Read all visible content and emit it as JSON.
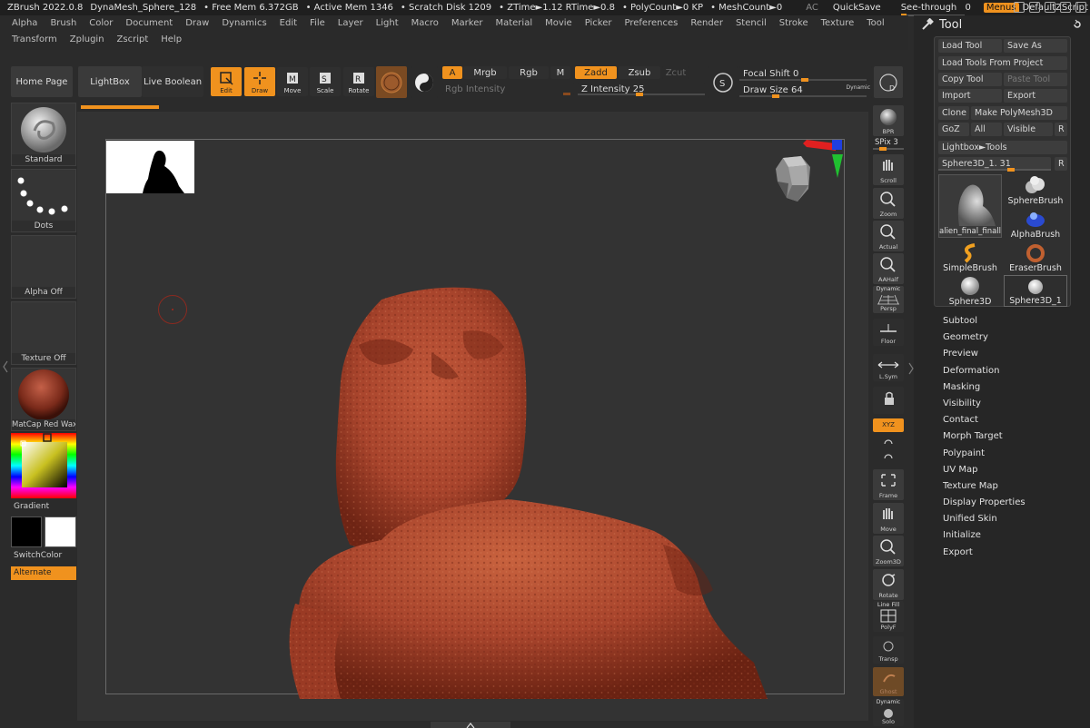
{
  "titlebar": {
    "app": "ZBrush 2022.0.8",
    "document": "DynaMesh_Sphere_128",
    "free_mem": "• Free Mem 6.372GB",
    "active_mem": "• Active Mem 1346",
    "scratch_disk": "• Scratch Disk 1209",
    "timing": "• ZTime►1.12 RTime►0.8",
    "polycount": "• PolyCount►0 KP",
    "meshcount": "• MeshCount►0",
    "ac": "AC",
    "quicksave": "QuickSave",
    "see_through": "See-through",
    "see_through_value": "0",
    "menus": "Menus",
    "default_zscript": "DefaultZScript"
  },
  "menubar": {
    "items": [
      "Alpha",
      "Brush",
      "Color",
      "Document",
      "Draw",
      "Dynamics",
      "Edit",
      "File",
      "Layer",
      "Light",
      "Macro",
      "Marker",
      "Material",
      "Movie",
      "Picker",
      "Preferences",
      "Render",
      "Stencil",
      "Stroke",
      "Texture",
      "Tool",
      "Transform",
      "Zplugin",
      "Zscript",
      "Help"
    ]
  },
  "toolbar": {
    "home_page": "Home Page",
    "lightbox": "LightBox",
    "live_boolean": "Live Boolean",
    "edit": "Edit",
    "draw": "Draw",
    "move": "Move",
    "scale": "Scale",
    "rotate": "Rotate",
    "a": "A",
    "mrgb": "Mrgb",
    "rgb": "Rgb",
    "m": "M",
    "rgb_intensity": "Rgb Intensity",
    "zadd": "Zadd",
    "zsub": "Zsub",
    "zcut": "Zcut",
    "z_intensity": "Z Intensity 25",
    "focal_shift": "Focal Shift 0",
    "draw_size": "Draw Size 64",
    "dynamic": "Dynamic",
    "s_label": "S",
    "d_label": "D"
  },
  "left_panel": {
    "standard": "Standard",
    "dots": "Dots",
    "alpha_off": "Alpha Off",
    "texture_off": "Texture Off",
    "matcap": "MatCap Red Wax",
    "gradient": "Gradient",
    "switch_color": "SwitchColor",
    "alternate": "Alternate"
  },
  "right_shelf": {
    "bpr": "BPR",
    "spix": "SPix 3",
    "scroll": "Scroll",
    "zoom": "Zoom",
    "actual": "Actual",
    "aahalf": "AAHalf",
    "dynamic": "Dynamic",
    "persp": "Persp",
    "floor": "Floor",
    "lsym": "L.Sym",
    "xyz": "XYZ",
    "frame": "Frame",
    "move": "Move",
    "zoom3d": "Zoom3D",
    "rotate": "Rotate",
    "line_fill": "Line Fill",
    "polyf": "PolyF",
    "transp": "Transp",
    "ghost": "Ghost",
    "dynamic2": "Dynamic",
    "solo": "Solo"
  },
  "tool_panel": {
    "title": "Tool",
    "load_tool": "Load Tool",
    "save_as": "Save As",
    "load_from_project": "Load Tools From Project",
    "copy_tool": "Copy Tool",
    "paste_tool": "Paste Tool",
    "import": "Import",
    "export": "Export",
    "clone": "Clone",
    "make_polymesh": "Make PolyMesh3D",
    "goz": "GoZ",
    "all": "All",
    "visible": "Visible",
    "r": "R",
    "lightbox_tools": "Lightbox►Tools",
    "sphere_slider": "Sphere3D_1. 31",
    "r2": "R",
    "thumbs": {
      "alien": "alien_final_finall",
      "spherebrush": "SphereBrush",
      "alphabrush": "AlphaBrush",
      "simplebrush": "SimpleBrush",
      "eraserbrush": "EraserBrush",
      "sphere3d": "Sphere3D",
      "sphere3d_1": "Sphere3D_1"
    },
    "sections": [
      "Subtool",
      "Geometry",
      "Preview",
      "Deformation",
      "Masking",
      "Visibility",
      "Contact",
      "Morph Target",
      "Polypaint",
      "UV Map",
      "Texture Map",
      "Display Properties",
      "Unified Skin",
      "Initialize",
      "Export"
    ]
  },
  "colors": {
    "accent": "#f0921e",
    "background": "#2b2b2b",
    "viewport": "#333333",
    "model": "#a8442c"
  }
}
